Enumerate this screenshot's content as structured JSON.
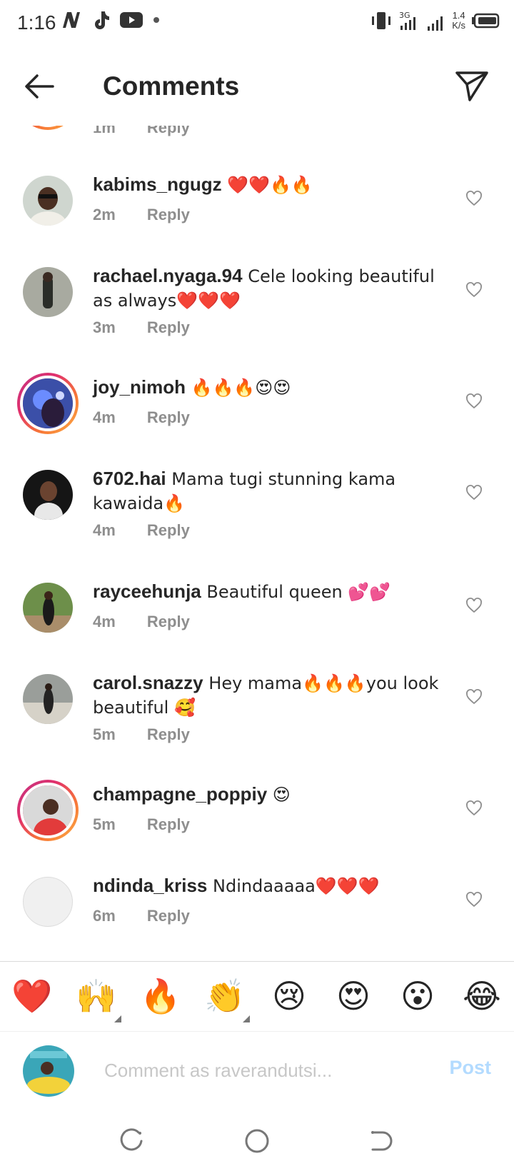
{
  "status_bar": {
    "time": "1:16",
    "net_speed_value": "1.4",
    "net_speed_unit": "K/s",
    "mobile_type": "3G"
  },
  "header": {
    "title": "Comments"
  },
  "comments": [
    {
      "username": "",
      "text": "",
      "time": "1m",
      "reply_label": "Reply"
    },
    {
      "username": "kabims_ngugz",
      "text": " ❤️❤️🔥🔥",
      "time": "2m",
      "reply_label": "Reply"
    },
    {
      "username": "rachael.nyaga.94",
      "text": " Cele looking beautiful as always❤️❤️❤️",
      "time": "3m",
      "reply_label": "Reply"
    },
    {
      "username": "joy_nimoh",
      "text": " 🔥🔥🔥😍😍",
      "time": "4m",
      "reply_label": "Reply"
    },
    {
      "username": "6702.hai",
      "text": " Mama tugi stunning kama kawaida🔥",
      "time": "4m",
      "reply_label": "Reply"
    },
    {
      "username": "rayceehunja",
      "text": " Beautiful queen 💕💕",
      "time": "4m",
      "reply_label": "Reply"
    },
    {
      "username": "carol.snazzy",
      "text": " Hey mama🔥🔥🔥you look beautiful 🥰",
      "time": "5m",
      "reply_label": "Reply"
    },
    {
      "username": "champagne_poppiy",
      "text": " 😍",
      "time": "5m",
      "reply_label": "Reply"
    },
    {
      "username": "ndinda_kriss",
      "text": " Ndindaaaaa❤️❤️❤️",
      "time": "6m",
      "reply_label": "Reply"
    }
  ],
  "quick_emojis": [
    "❤️",
    "🙌",
    "🔥",
    "👏",
    "😢",
    "😍",
    "😮",
    "😂"
  ],
  "composer": {
    "placeholder": "Comment as raverandutsi...",
    "post_label": "Post"
  },
  "colors": {
    "story_ring": "#e1306c",
    "post_disabled": "#b3dbff",
    "meta_gray": "#8e8e8e"
  }
}
